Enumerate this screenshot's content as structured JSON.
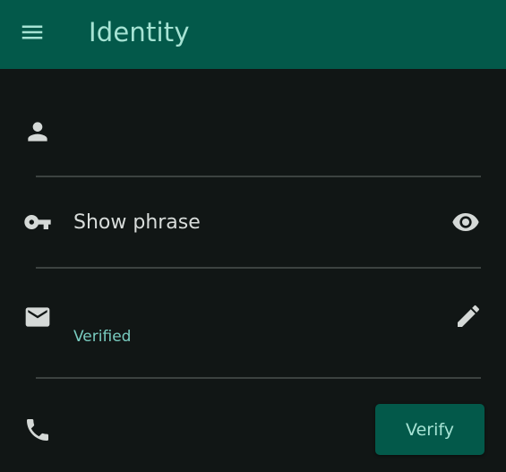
{
  "colors": {
    "app_bar": "#03594a",
    "background": "#111615",
    "accent_text": "#a6e3d4",
    "status_text": "#79ccc0",
    "icon": "#d5d9d7",
    "divider": "#3c4240"
  },
  "app_bar": {
    "title": "Identity",
    "menu_icon": "menu-icon"
  },
  "identity": {
    "name_row": {
      "icon": "person-icon",
      "value": ""
    },
    "phrase_row": {
      "icon": "key-icon",
      "label": "Show phrase",
      "action_icon": "eye-icon"
    },
    "email_row": {
      "icon": "mail-icon",
      "value": "",
      "status": "Verified",
      "action_icon": "pencil-icon"
    },
    "phone_row": {
      "icon": "phone-icon",
      "value": "",
      "button_label": "Verify"
    }
  }
}
